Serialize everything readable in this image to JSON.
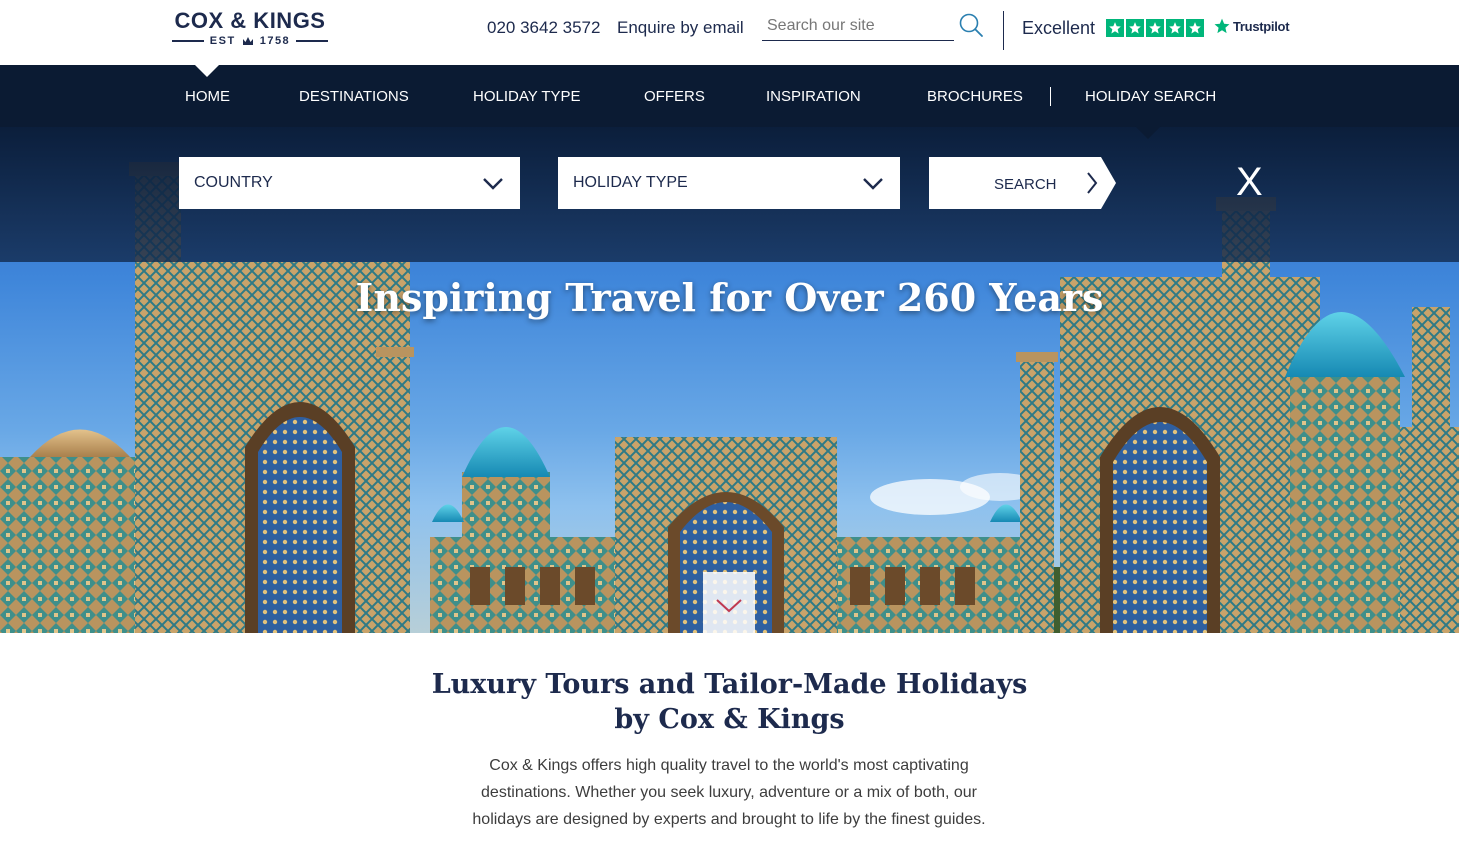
{
  "brand": {
    "name": "COX & KINGS",
    "established": "EST",
    "year": "1758"
  },
  "header": {
    "phone": "020 3642 3572",
    "enquire": "Enquire by email",
    "search_placeholder": "Search our site",
    "trustpilot_rating": "Excellent",
    "trustpilot_stars": 5,
    "trustpilot_brand": "Trustpilot"
  },
  "nav": {
    "items": [
      {
        "label": "HOME"
      },
      {
        "label": "DESTINATIONS"
      },
      {
        "label": "HOLIDAY TYPE"
      },
      {
        "label": "OFFERS"
      },
      {
        "label": "INSPIRATION"
      },
      {
        "label": "BROCHURES"
      },
      {
        "label": "HOLIDAY SEARCH"
      }
    ],
    "active": "HOME"
  },
  "search_panel": {
    "country_label": "COUNTRY",
    "holiday_type_label": "HOLIDAY TYPE",
    "search_label": "SEARCH",
    "close_label": "X"
  },
  "hero": {
    "title": "Inspiring Travel for Over 260 Years"
  },
  "intro": {
    "title_line1": "Luxury Tours and Tailor-Made Holidays",
    "title_line2": "by Cox & Kings",
    "text": "Cox & Kings offers high quality travel to the world's most captivating destinations. Whether you seek luxury, adventure or a mix of both, our holidays are designed by experts and brought to life by the finest guides."
  },
  "colors": {
    "navy": "#0b1b33",
    "brand_navy": "#1d2a4d",
    "trustpilot_green": "#00b67a",
    "scroll_chevron": "#c0394f"
  }
}
